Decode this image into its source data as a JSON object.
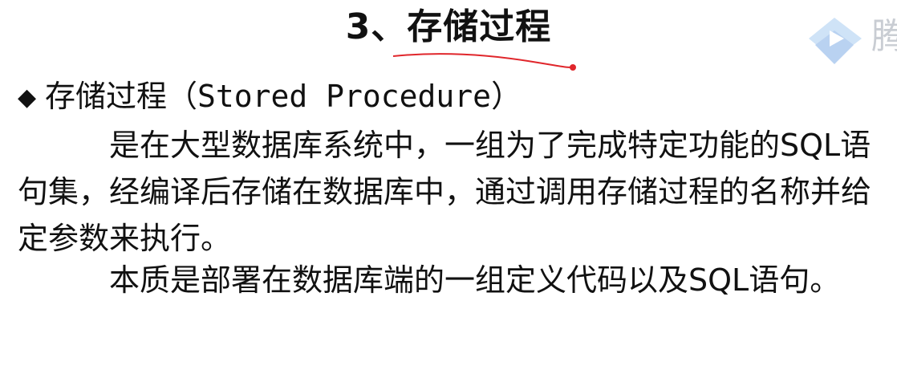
{
  "slide": {
    "title": "3、存储过程",
    "heading": {
      "bullet": "◆",
      "term": "存储过程（",
      "english": "Stored Procedure",
      "close": "）"
    },
    "paragraphs": [
      "是在大型数据库系统中，一组为了完成特定功能的SQL语句集，经编译后存储在数据库中，通过调用存储过程的名称并给定参数来执行。",
      "本质是部署在数据库端的一组定义代码以及SQL语句。"
    ]
  },
  "watermark": {
    "icon": "play-logo-icon",
    "text": "腾",
    "color": "#c9cdd3"
  },
  "annotation": {
    "icon": "pen-underline-icon",
    "color": "#e0262b"
  }
}
